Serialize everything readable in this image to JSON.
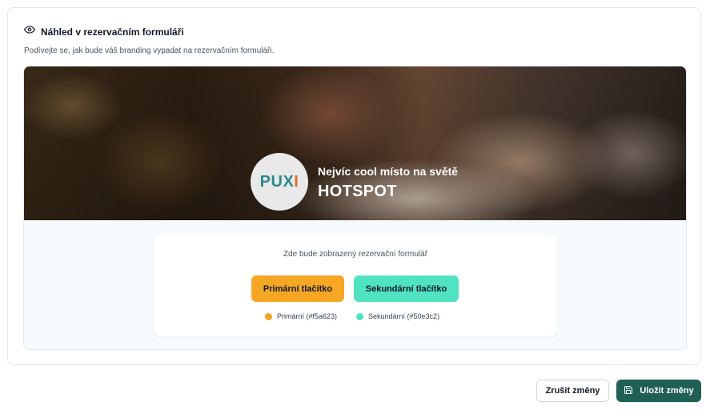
{
  "preview_card": {
    "title": "Náhled v rezervačním formuláři",
    "subtitle": "Podívejte se, jak bude váš branding vypadat na rezervačním formuláři.",
    "title_icon": "eye-icon"
  },
  "banner": {
    "logo_text_part1": "PUX",
    "logo_text_part2": "I",
    "tagline": "Nejvíc cool místo na světě",
    "name": "HOTSPOT"
  },
  "form_preview": {
    "note": "Zde bude zobrazený rezervační formulář",
    "primary_button_label": "Primární tlačítko",
    "secondary_button_label": "Sekundární tlačítko",
    "primary_color_label": "Primární (#f5a623)",
    "secondary_color_label": "Sekundární (#50e3c2)"
  },
  "colors": {
    "primary": "#f5a623",
    "secondary": "#50e3c2",
    "save_button": "#1f5f55"
  },
  "footer": {
    "cancel_label": "Zrušit změny",
    "save_label": "Uložit změny",
    "save_icon": "save-icon"
  }
}
